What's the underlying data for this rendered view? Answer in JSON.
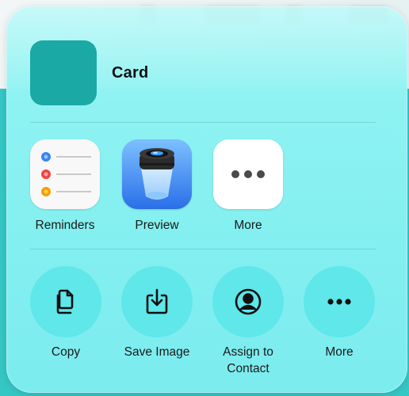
{
  "header": {
    "title": "Card",
    "thumbnail_color": "#1aa9a5"
  },
  "apps": [
    {
      "label": "Reminders",
      "icon": "reminders-icon"
    },
    {
      "label": "Preview",
      "icon": "preview-icon"
    },
    {
      "label": "More",
      "icon": "more-icon"
    }
  ],
  "actions": [
    {
      "label": "Copy",
      "icon": "copy-icon"
    },
    {
      "label": "Save Image",
      "icon": "save-image-icon"
    },
    {
      "label": "Assign to\nContact",
      "icon": "contact-icon"
    },
    {
      "label": "More",
      "icon": "more-icon"
    }
  ],
  "colors": {
    "background_teal": "#35c7c4",
    "action_circle": "#5fe7ea",
    "sheet": "#8ff2f2"
  }
}
